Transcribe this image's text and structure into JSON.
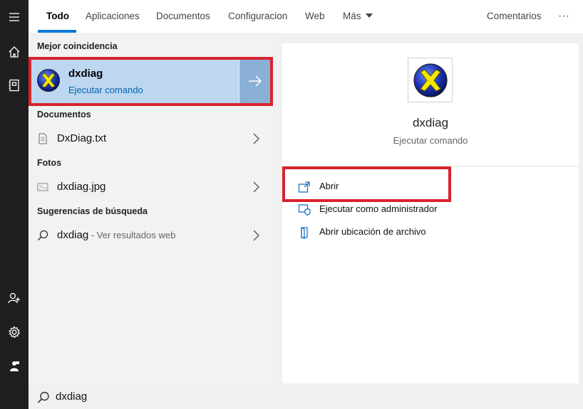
{
  "tabs": [
    {
      "label": "Todo"
    },
    {
      "label": "Aplicaciones"
    },
    {
      "label": "Documentos"
    },
    {
      "label": "Configuracion"
    },
    {
      "label": "Web"
    },
    {
      "label": "Más"
    }
  ],
  "header": {
    "feedback_label": "Comentarios",
    "more_label": "···"
  },
  "results": {
    "best_match_heading": "Mejor coincidencia",
    "best_match": {
      "title": "dxdiag",
      "subtitle": "Ejecutar comando"
    },
    "documents_heading": "Documentos",
    "document": {
      "name": "DxDiag.txt"
    },
    "photos_heading": "Fotos",
    "photo": {
      "name": "dxdiag.jpg"
    },
    "suggestions_heading": "Sugerencias de búsqueda",
    "suggestion": {
      "query": "dxdiag",
      "hint": " - Ver resultados web"
    }
  },
  "detail": {
    "title": "dxdiag",
    "subtitle": "Ejecutar comando",
    "actions": [
      {
        "label": "Abrir",
        "icon": "open-icon"
      },
      {
        "label": "Ejecutar como administrador",
        "icon": "admin-shield-icon"
      },
      {
        "label": "Abrir ubicación de archivo",
        "icon": "file-location-icon"
      }
    ]
  },
  "search": {
    "value": "dxdiag"
  },
  "colors": {
    "accent": "#0078d7",
    "highlight": "#bcd7ef",
    "annotation_red": "#d9222e"
  }
}
